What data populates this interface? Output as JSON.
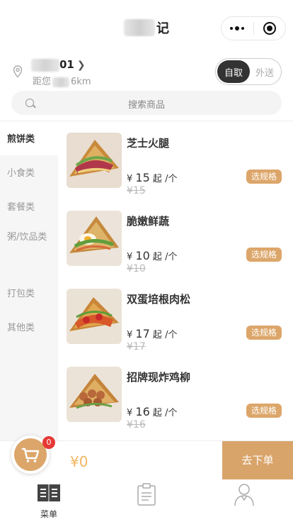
{
  "header": {
    "title_suffix": "记"
  },
  "store": {
    "name_suffix": "01",
    "distance_prefix": "距您",
    "distance_value": "6km"
  },
  "delivery_toggle": {
    "pickup": "自取",
    "delivery": "外送",
    "selected": "pickup"
  },
  "search": {
    "placeholder": "搜索商品"
  },
  "categories": [
    {
      "label": "煎饼类",
      "active": true
    },
    {
      "label": "小食类",
      "active": false
    },
    {
      "label": "套餐类",
      "active": false
    },
    {
      "label": "粥/饮品类",
      "active": false
    },
    {
      "label": "打包类",
      "active": false
    },
    {
      "label": "其他类",
      "active": false
    }
  ],
  "products": [
    {
      "name": "芝士火腿",
      "currency": "¥",
      "price": "15",
      "from": "起",
      "unit": "/个",
      "original": "¥15",
      "spec": "选规格"
    },
    {
      "name": "脆嫩鲜蔬",
      "currency": "¥",
      "price": "10",
      "from": "起",
      "unit": "/个",
      "original": "¥10",
      "spec": "选规格"
    },
    {
      "name": "双蛋培根肉松",
      "currency": "¥",
      "price": "17",
      "from": "起",
      "unit": "/个",
      "original": "¥17",
      "spec": "选规格"
    },
    {
      "name": "招牌现炸鸡柳",
      "currency": "¥",
      "price": "16",
      "from": "起",
      "unit": "/个",
      "original": "¥16",
      "spec": "选规格"
    }
  ],
  "cart": {
    "badge_count": "0",
    "total": "¥0",
    "checkout": "去下单"
  },
  "tabbar": {
    "menu": "菜单"
  },
  "colors": {
    "accent": "#dca66a",
    "total": "#f3b660",
    "badge": "#e53935"
  }
}
